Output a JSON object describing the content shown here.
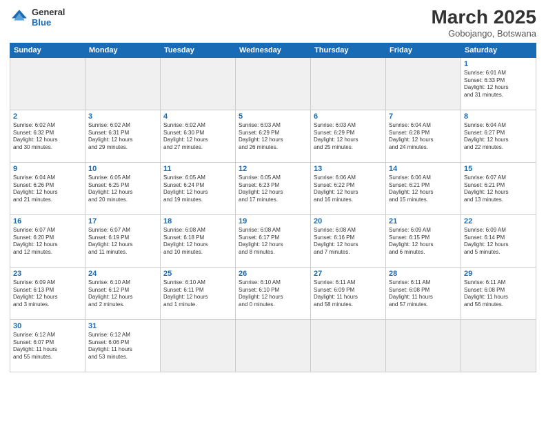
{
  "header": {
    "logo_line1": "General",
    "logo_line2": "Blue",
    "month": "March 2025",
    "location": "Gobojango, Botswana"
  },
  "days_of_week": [
    "Sunday",
    "Monday",
    "Tuesday",
    "Wednesday",
    "Thursday",
    "Friday",
    "Saturday"
  ],
  "weeks": [
    [
      {
        "num": "",
        "info": ""
      },
      {
        "num": "",
        "info": ""
      },
      {
        "num": "",
        "info": ""
      },
      {
        "num": "",
        "info": ""
      },
      {
        "num": "",
        "info": ""
      },
      {
        "num": "",
        "info": ""
      },
      {
        "num": "1",
        "info": "Sunrise: 6:01 AM\nSunset: 6:33 PM\nDaylight: 12 hours\nand 31 minutes."
      }
    ],
    [
      {
        "num": "2",
        "info": "Sunrise: 6:02 AM\nSunset: 6:32 PM\nDaylight: 12 hours\nand 30 minutes."
      },
      {
        "num": "3",
        "info": "Sunrise: 6:02 AM\nSunset: 6:31 PM\nDaylight: 12 hours\nand 29 minutes."
      },
      {
        "num": "4",
        "info": "Sunrise: 6:02 AM\nSunset: 6:30 PM\nDaylight: 12 hours\nand 27 minutes."
      },
      {
        "num": "5",
        "info": "Sunrise: 6:03 AM\nSunset: 6:29 PM\nDaylight: 12 hours\nand 26 minutes."
      },
      {
        "num": "6",
        "info": "Sunrise: 6:03 AM\nSunset: 6:29 PM\nDaylight: 12 hours\nand 25 minutes."
      },
      {
        "num": "7",
        "info": "Sunrise: 6:04 AM\nSunset: 6:28 PM\nDaylight: 12 hours\nand 24 minutes."
      },
      {
        "num": "8",
        "info": "Sunrise: 6:04 AM\nSunset: 6:27 PM\nDaylight: 12 hours\nand 22 minutes."
      }
    ],
    [
      {
        "num": "9",
        "info": "Sunrise: 6:04 AM\nSunset: 6:26 PM\nDaylight: 12 hours\nand 21 minutes."
      },
      {
        "num": "10",
        "info": "Sunrise: 6:05 AM\nSunset: 6:25 PM\nDaylight: 12 hours\nand 20 minutes."
      },
      {
        "num": "11",
        "info": "Sunrise: 6:05 AM\nSunset: 6:24 PM\nDaylight: 12 hours\nand 19 minutes."
      },
      {
        "num": "12",
        "info": "Sunrise: 6:05 AM\nSunset: 6:23 PM\nDaylight: 12 hours\nand 17 minutes."
      },
      {
        "num": "13",
        "info": "Sunrise: 6:06 AM\nSunset: 6:22 PM\nDaylight: 12 hours\nand 16 minutes."
      },
      {
        "num": "14",
        "info": "Sunrise: 6:06 AM\nSunset: 6:21 PM\nDaylight: 12 hours\nand 15 minutes."
      },
      {
        "num": "15",
        "info": "Sunrise: 6:07 AM\nSunset: 6:21 PM\nDaylight: 12 hours\nand 13 minutes."
      }
    ],
    [
      {
        "num": "16",
        "info": "Sunrise: 6:07 AM\nSunset: 6:20 PM\nDaylight: 12 hours\nand 12 minutes."
      },
      {
        "num": "17",
        "info": "Sunrise: 6:07 AM\nSunset: 6:19 PM\nDaylight: 12 hours\nand 11 minutes."
      },
      {
        "num": "18",
        "info": "Sunrise: 6:08 AM\nSunset: 6:18 PM\nDaylight: 12 hours\nand 10 minutes."
      },
      {
        "num": "19",
        "info": "Sunrise: 6:08 AM\nSunset: 6:17 PM\nDaylight: 12 hours\nand 8 minutes."
      },
      {
        "num": "20",
        "info": "Sunrise: 6:08 AM\nSunset: 6:16 PM\nDaylight: 12 hours\nand 7 minutes."
      },
      {
        "num": "21",
        "info": "Sunrise: 6:09 AM\nSunset: 6:15 PM\nDaylight: 12 hours\nand 6 minutes."
      },
      {
        "num": "22",
        "info": "Sunrise: 6:09 AM\nSunset: 6:14 PM\nDaylight: 12 hours\nand 5 minutes."
      }
    ],
    [
      {
        "num": "23",
        "info": "Sunrise: 6:09 AM\nSunset: 6:13 PM\nDaylight: 12 hours\nand 3 minutes."
      },
      {
        "num": "24",
        "info": "Sunrise: 6:10 AM\nSunset: 6:12 PM\nDaylight: 12 hours\nand 2 minutes."
      },
      {
        "num": "25",
        "info": "Sunrise: 6:10 AM\nSunset: 6:11 PM\nDaylight: 12 hours\nand 1 minute."
      },
      {
        "num": "26",
        "info": "Sunrise: 6:10 AM\nSunset: 6:10 PM\nDaylight: 12 hours\nand 0 minutes."
      },
      {
        "num": "27",
        "info": "Sunrise: 6:11 AM\nSunset: 6:09 PM\nDaylight: 11 hours\nand 58 minutes."
      },
      {
        "num": "28",
        "info": "Sunrise: 6:11 AM\nSunset: 6:08 PM\nDaylight: 11 hours\nand 57 minutes."
      },
      {
        "num": "29",
        "info": "Sunrise: 6:11 AM\nSunset: 6:08 PM\nDaylight: 11 hours\nand 56 minutes."
      }
    ],
    [
      {
        "num": "30",
        "info": "Sunrise: 6:12 AM\nSunset: 6:07 PM\nDaylight: 11 hours\nand 55 minutes."
      },
      {
        "num": "31",
        "info": "Sunrise: 6:12 AM\nSunset: 6:06 PM\nDaylight: 11 hours\nand 53 minutes."
      },
      {
        "num": "",
        "info": ""
      },
      {
        "num": "",
        "info": ""
      },
      {
        "num": "",
        "info": ""
      },
      {
        "num": "",
        "info": ""
      },
      {
        "num": "",
        "info": ""
      }
    ]
  ]
}
